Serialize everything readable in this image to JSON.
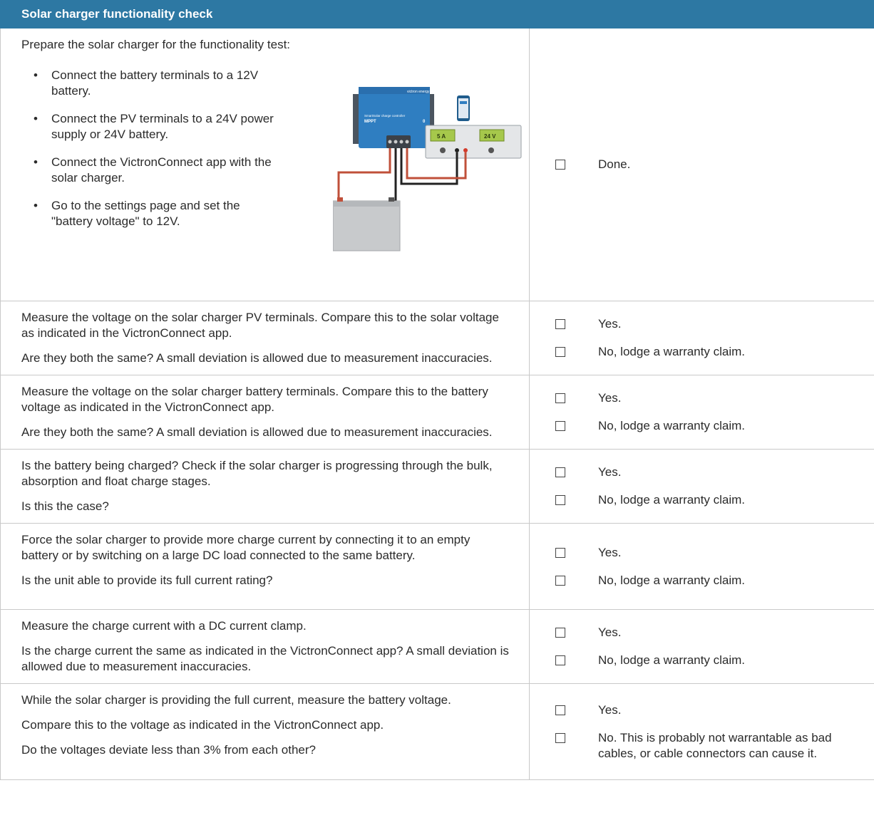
{
  "header": {
    "title": "Solar charger functionality check"
  },
  "illustration": {
    "controller_brand": "victron energy",
    "controller_line1": "SmartSolar charge controller",
    "controller_line2": "MPPT",
    "psu_current": "5 A",
    "psu_voltage": "24 V"
  },
  "rows": [
    {
      "intro": "Prepare the solar charger for the functionality test:",
      "bullets": [
        "Connect the battery terminals to a 12V battery.",
        "Connect the PV terminals to a 24V power supply or 24V battery.",
        "Connect the VictronConnect app with the solar charger.",
        "Go to the settings page and set the \"battery voltage\" to 12V."
      ],
      "answers": [
        "Done."
      ]
    },
    {
      "paragraphs": [
        "Measure the voltage on the solar charger PV terminals. Compare this to the solar voltage as indicated in the VictronConnect app.",
        "Are they both the same? A small deviation is allowed due to measurement inaccuracies."
      ],
      "answers": [
        "Yes.",
        "No, lodge a warranty claim."
      ]
    },
    {
      "paragraphs": [
        "Measure the voltage on the solar charger battery terminals. Compare this to the battery voltage as indicated in the VictronConnect app.",
        "Are they both the same? A small deviation is allowed due to measurement inaccuracies."
      ],
      "answers": [
        "Yes.",
        "No, lodge a warranty claim."
      ]
    },
    {
      "paragraphs": [
        "Is the battery being charged? Check if the solar charger is progressing through the bulk, absorption and float charge stages.",
        "Is this the case?"
      ],
      "answers": [
        "Yes.",
        "No, lodge a warranty claim."
      ]
    },
    {
      "paragraphs": [
        "Force the solar charger to provide more charge current by connecting it to an empty battery or by switching on a large DC load connected to the same battery.",
        "Is the unit able to provide its full current rating?"
      ],
      "answers": [
        "Yes.",
        "No, lodge a warranty claim."
      ]
    },
    {
      "paragraphs": [
        "Measure the charge current with a DC current clamp.",
        "Is the charge current the same as indicated in the VictronConnect app? A small deviation is allowed due to measurement inaccuracies."
      ],
      "answers": [
        "Yes.",
        "No, lodge a warranty claim."
      ]
    },
    {
      "paragraphs": [
        "While the solar charger is providing the full current, measure the battery voltage.",
        "Compare this to the voltage as indicated in the VictronConnect app.",
        "Do the voltages deviate less than 3% from each other?"
      ],
      "answers": [
        "Yes.",
        "No. This is probably not warrantable as bad cables, or cable connectors can cause it."
      ]
    }
  ]
}
